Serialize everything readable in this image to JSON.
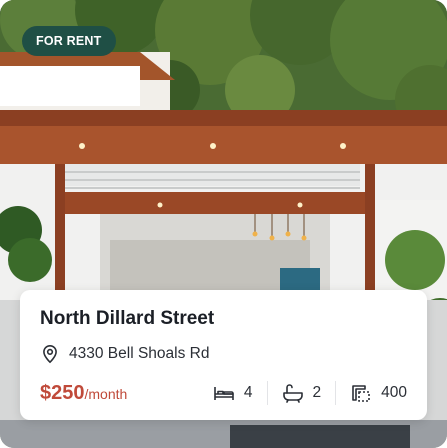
{
  "listing": {
    "badge": "FOR RENT",
    "title": "North Dillard Street",
    "address": "4330 Bell Shoals Rd",
    "price": "$250",
    "period": "/month",
    "beds": "4",
    "baths": "2",
    "area": "400"
  },
  "colors": {
    "badge_bg": "#1f4f45",
    "price": "#c04a3a"
  },
  "icons": {
    "location": "location-pin-icon",
    "beds": "bed-icon",
    "baths": "bathtub-icon",
    "area": "area-icon"
  }
}
